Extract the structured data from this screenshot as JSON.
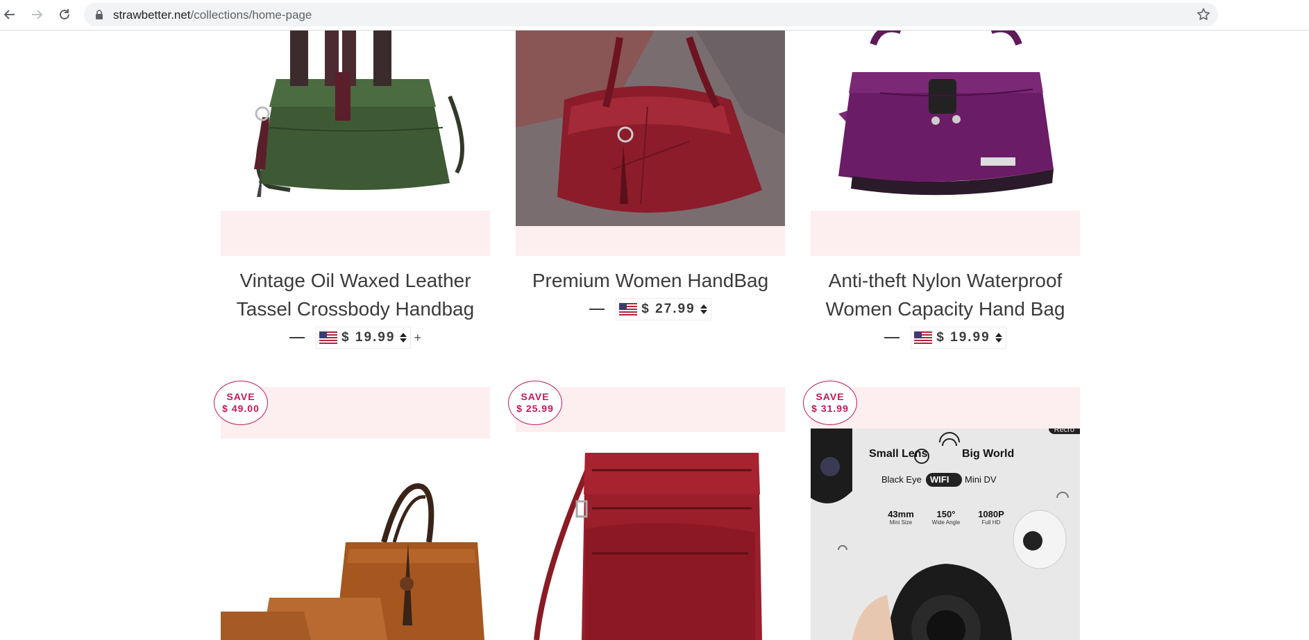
{
  "browser": {
    "url_host": "strawbetter.net",
    "url_path": "/collections/home-page"
  },
  "products_row1": [
    {
      "title_line1": "Vintage Oil Waxed Leather",
      "title_line2": "Tassel Crossbody Handbag",
      "price": "$ 19.99",
      "extra": "+"
    },
    {
      "title_line1": "Premium Women HandBag",
      "title_line2": "",
      "price": "$ 27.99"
    },
    {
      "title_line1": "Anti-theft Nylon Waterproof",
      "title_line2": "Women Capacity Hand Bag",
      "price": "$ 19.99"
    }
  ],
  "products_row2": [
    {
      "save_label": "SAVE",
      "save_amount": "$ 49.00"
    },
    {
      "save_label": "SAVE",
      "save_amount": "$ 25.99"
    },
    {
      "save_label": "SAVE",
      "save_amount": "$ 31.99"
    }
  ],
  "camera_ad": {
    "headline_a": "Small Lens",
    "headline_b": "Big World",
    "sub_a": "Black Eye",
    "sub_wifi": "WIFI",
    "sub_b": "Mini DV",
    "specs": [
      {
        "value": "43mm",
        "label": "Mini Size"
      },
      {
        "value": "150°",
        "label": "Wide Angle"
      },
      {
        "value": "1080P",
        "label": "Full HD"
      }
    ],
    "corner_tag": "Recro"
  },
  "colors": {
    "accent": "#c2185b",
    "pink_band": "#fdeef0",
    "text": "#3b3b3b"
  }
}
